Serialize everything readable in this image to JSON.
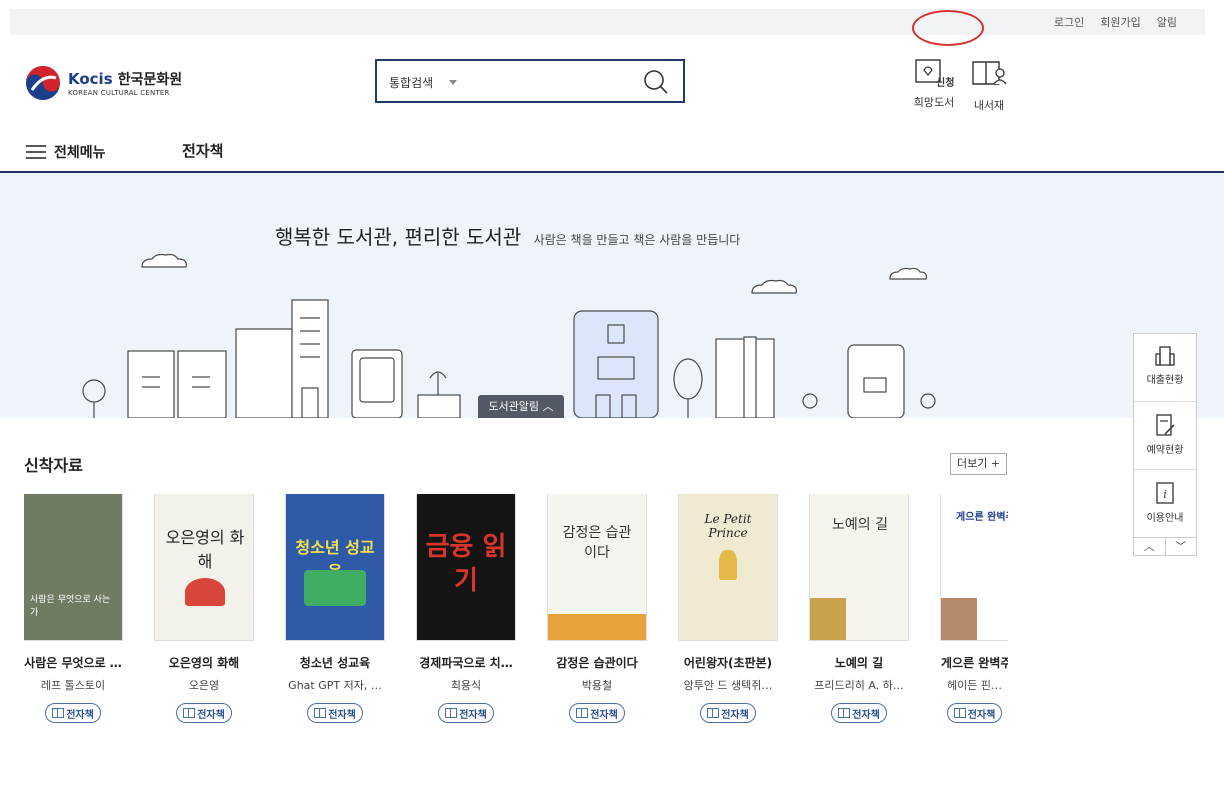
{
  "topbar": {
    "links": [
      "로그인",
      "회원가입",
      "알림"
    ]
  },
  "logo": {
    "brand": "Kocis",
    "korean": "한국문화원",
    "english": "KOREAN CULTURAL CENTER"
  },
  "search": {
    "scope": "통합검색",
    "placeholder": ""
  },
  "utilities": {
    "wish_label": "희망도서",
    "wish_badge": "신청",
    "library_label": "내서재"
  },
  "nav": {
    "menu_label": "전체메뉴",
    "ebook_label": "전자책"
  },
  "hero": {
    "title": "행복한 도서관, 편리한 도서관",
    "subtitle": "사람은 책을 만들고 책은 사람을 만듭니다",
    "notice_tab": "도서관알림 ︿"
  },
  "new_arrivals": {
    "title": "신착자료",
    "more_label": "더보기 +",
    "badge_label": "전자책",
    "books": [
      {
        "title": "사람은 무엇으로 …",
        "author": "레프 톨스토이",
        "cover_color": "#6f7b63",
        "cover_text": "사람은 무엇으로 사는가"
      },
      {
        "title": "오은영의 화해",
        "author": "오은영",
        "cover_color": "#f4f1ea",
        "cover_text": "오은영의 화해"
      },
      {
        "title": "청소년 성교육",
        "author": "Ghat GPT 저자, …",
        "cover_color": "#2f5aa8",
        "cover_text": "청소년 성교육"
      },
      {
        "title": "경제파국으로 치…",
        "author": "최용식",
        "cover_color": "#141414",
        "cover_text": "금융 읽기"
      },
      {
        "title": "감정은 습관이다",
        "author": "박용철",
        "cover_color": "#f6f4ef",
        "cover_text": "감정은 습관이다"
      },
      {
        "title": "어린왕자(초판본)",
        "author": "앙투안 드 생텍쥐…",
        "cover_color": "#f1ead2",
        "cover_text": "Le Petit Prince"
      },
      {
        "title": "노예의 길",
        "author": "프리드리히 A. 하…",
        "cover_color": "#f7f4ee",
        "cover_text": "노예의 길"
      },
      {
        "title": "게으른 완벽주…",
        "author": "헤이든 핀…",
        "cover_color": "#ffffff",
        "cover_text": "게으른 완벽주의"
      }
    ]
  },
  "quick_menu": {
    "items": [
      "대출현황",
      "예약현황",
      "이용안내"
    ],
    "up": "︿",
    "down": "﹀"
  }
}
